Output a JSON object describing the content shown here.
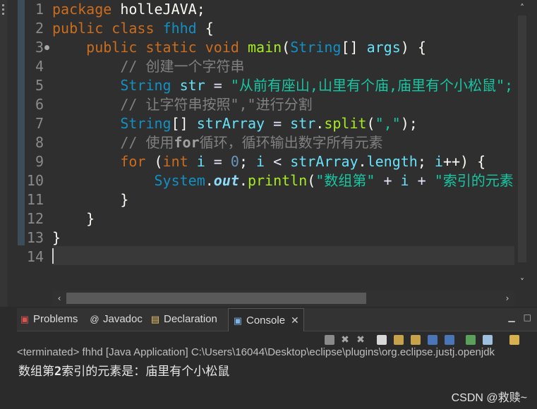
{
  "editor": {
    "line_numbers": [
      "1",
      "2",
      "3",
      "4",
      "5",
      "6",
      "7",
      "8",
      "9",
      "10",
      "11",
      "12",
      "13",
      "14"
    ],
    "code": {
      "l1": {
        "kw": "package",
        "name": "holleJAVA;"
      },
      "l2": {
        "kw1": "public",
        "kw2": "class",
        "cls": "fhhd",
        "brace": "{"
      },
      "l3": {
        "kw1": "public",
        "kw2": "static",
        "kw3": "void",
        "method": "main",
        "type": "String",
        "arr": "[] ",
        "param": "args",
        "rest": ") {"
      },
      "l4": {
        "comment": "// 创建一个字符串"
      },
      "l5": {
        "type": "String",
        "var": "str",
        "eq": " = ",
        "str": "\"从前有座山,山里有个庙,庙里有个小松鼠\";"
      },
      "l6": {
        "comment": "// 让字符串按照\",\"进行分割"
      },
      "l7": {
        "type": "String",
        "arr": "[] ",
        "var": "strArray",
        "eq": " = ",
        "obj": "str",
        "dot": ".",
        "method": "split",
        "open": "(",
        "str": "\",\"",
        "close": ");"
      },
      "l8": {
        "c1": "// 使用",
        "kw": "for",
        "c2": "循环，循环输出数字所有元素"
      },
      "l9": {
        "kw": "for",
        "p1": " (",
        "kw2": "int",
        "var": "i",
        "eq": " = ",
        "num": "0",
        "semi": "; ",
        "var2": "i",
        "lt": " < ",
        "obj": "strArray",
        "dot": ".",
        "field": "length",
        "semi2": "; ",
        "var3": "i",
        "inc": "++) {"
      },
      "l10": {
        "cls": "System",
        "dot": ".",
        "out": "out",
        "dot2": ".",
        "method": "println",
        "open": "(",
        "str": "\"数组第\"",
        "plus": " + ",
        "var": "i",
        "plus2": " + ",
        "str2": "\"索引的元素是：\""
      },
      "l11": {
        "brace": "}"
      },
      "l12": {
        "brace": "}"
      },
      "l13": {
        "brace": "}"
      }
    }
  },
  "panel": {
    "tabs": [
      {
        "label": "Problems",
        "icon": "problems-icon"
      },
      {
        "label": "Javadoc",
        "icon": "javadoc-icon"
      },
      {
        "label": "Declaration",
        "icon": "declaration-icon"
      },
      {
        "label": "Console",
        "icon": "console-icon"
      }
    ],
    "status": "<terminated> fhhd [Java Application] C:\\Users\\16044\\Desktop\\eclipse\\plugins\\org.eclipse.justj.openjdk",
    "output": {
      "pre": "数组第",
      "num": "2",
      "post": "索引的元素是：庙里有个小松鼠"
    }
  },
  "watermark": "CSDN @救赎~",
  "colors": {
    "background": "#2f2f2f",
    "keyword": "#cc6c1d",
    "type": "#1290c3",
    "string": "#17c6a3",
    "comment": "#808080",
    "method": "#a7ec21"
  }
}
